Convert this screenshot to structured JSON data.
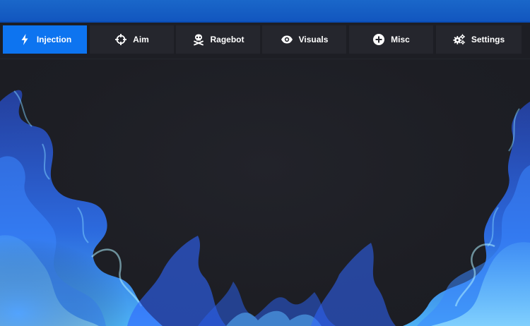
{
  "tabs": [
    {
      "label": "Injection",
      "icon": "lightning-bolt-icon",
      "active": true
    },
    {
      "label": "Aim",
      "icon": "crosshair-icon",
      "active": false
    },
    {
      "label": "Ragebot",
      "icon": "skull-crossbones-icon",
      "active": false
    },
    {
      "label": "Visuals",
      "icon": "eye-icon",
      "active": false
    },
    {
      "label": "Misc",
      "icon": "plus-circle-icon",
      "active": false
    },
    {
      "label": "Settings",
      "icon": "gears-icon",
      "active": false
    }
  ],
  "colors": {
    "titlebar": "#1256bf",
    "active_tab": "#0d74f0",
    "tab": "#25262d",
    "background": "#1d1e24",
    "flame": "#2f6cff"
  }
}
